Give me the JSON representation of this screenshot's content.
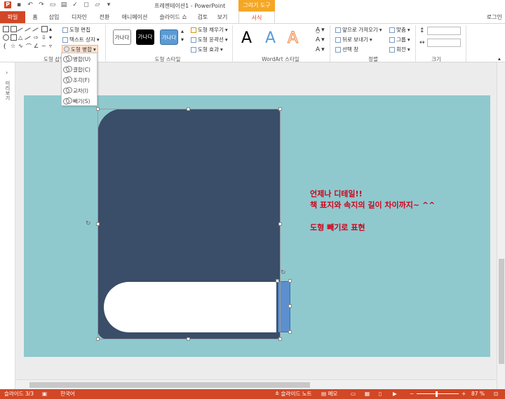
{
  "window": {
    "title": "프레젠테이션1 - PowerPoint",
    "context_tab_group": "그리기 도구",
    "login": "로그인"
  },
  "tabs": [
    "파일",
    "홈",
    "삽입",
    "디자인",
    "전환",
    "애니메이션",
    "슬라이드 쇼",
    "검토",
    "보기",
    "서식"
  ],
  "ribbon": {
    "insert_shapes": {
      "edit_shape": "도형 편집",
      "text_box": "텍스트 상자",
      "merge_shapes": "도형 병합",
      "label": "도형 삽입"
    },
    "shape_styles": {
      "presets": [
        "가나다",
        "가나다",
        "가나다"
      ],
      "fill": "도형 채우기",
      "outline": "도형 윤곽선",
      "effects": "도형 효과",
      "label": "도형 스타일"
    },
    "wordart": {
      "letters": [
        "A",
        "A",
        "A"
      ],
      "label": "WordArt 스타일"
    },
    "arrange": {
      "bring_forward": "앞으로 가져오기",
      "send_backward": "뒤로 보내기",
      "selection_pane": "선택 창",
      "align": "맞춤",
      "group": "그룹",
      "rotate": "회전",
      "label": "정렬"
    },
    "size": {
      "label": "크기"
    }
  },
  "merge_menu": [
    "병합(U)",
    "결합(C)",
    "조각(F)",
    "교차(I)",
    "빼기(S)"
  ],
  "thumbnail_pane": {
    "label": "미리보기"
  },
  "slide_text": {
    "line1": "언제나 디테일!!",
    "line2": "책 표지와 속지의 길이 차이까지~ ^^",
    "line3": "도형 빼기로 표현"
  },
  "colors": {
    "accent": "#d24726",
    "slide_bg": "#8fc9ce",
    "cover": "#3a4d69",
    "spine": "#5b8fcf",
    "text_red": "#d0021b"
  },
  "status": {
    "slide": "슬라이드 3/3",
    "language": "한국어",
    "notes": "슬라이드 노트",
    "comments": "메모",
    "zoom": "87 %",
    "zoom_level": 0.47
  }
}
